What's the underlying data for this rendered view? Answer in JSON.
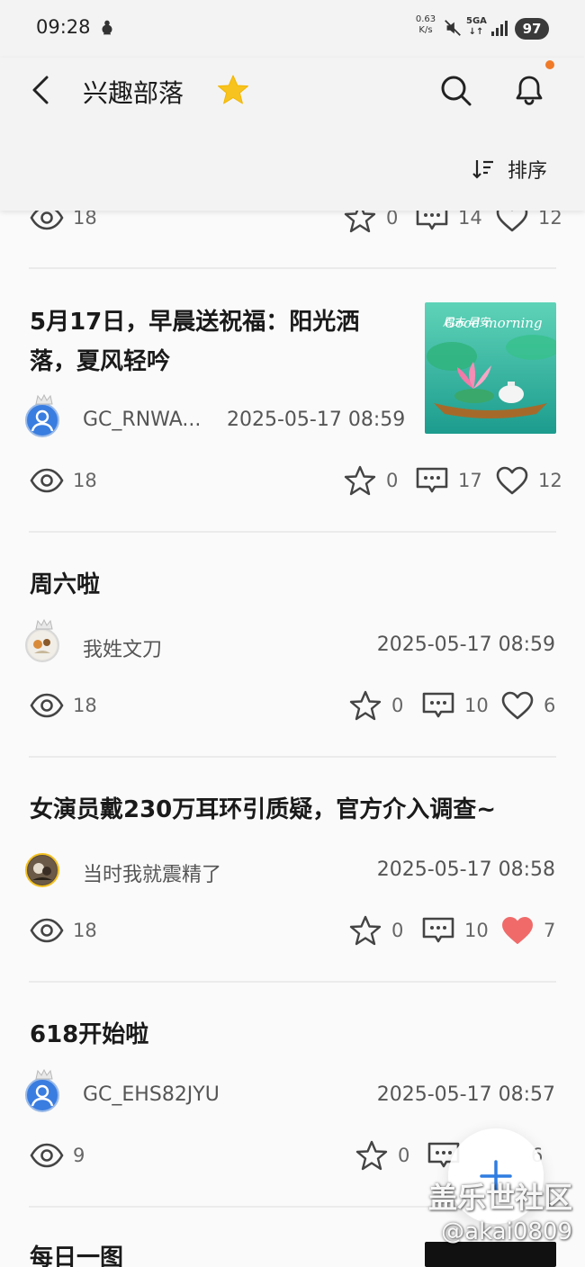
{
  "status_bar": {
    "time": "09:28",
    "net_speed_value": "0.63",
    "net_speed_unit": "K/s",
    "network": "5GA",
    "battery": "97"
  },
  "header": {
    "title": "兴趣部落",
    "sort_label": "排序",
    "accent": "#f7c31e",
    "notify_dot_color": "#f07a28"
  },
  "partial_post": {
    "views": "18",
    "favorites": "0",
    "comments": "14",
    "likes": "12"
  },
  "posts": [
    {
      "title": "5月17日，早晨送祝福：阳光洒落，夏风轻吟",
      "author": "GC_RNWA...",
      "time": "2025-05-17 08:59",
      "views": "18",
      "favorites": "0",
      "comments": "17",
      "likes": "12",
      "liked": false,
      "thumbnail_text": "Good morning",
      "thumbnail_caption": "周末·早安"
    },
    {
      "title": "周六啦",
      "author": "我姓文刀",
      "time": "2025-05-17 08:59",
      "views": "18",
      "favorites": "0",
      "comments": "10",
      "likes": "6",
      "liked": false
    },
    {
      "title": "女演员戴230万耳环引质疑，官方介入调查~",
      "author": "当时我就震精了",
      "time": "2025-05-17 08:58",
      "views": "18",
      "favorites": "0",
      "comments": "10",
      "likes": "7",
      "liked": true
    },
    {
      "title": "618开始啦",
      "author": "GC_EHS82JYU",
      "time": "2025-05-17 08:57",
      "views": "9",
      "favorites": "0",
      "comments": "",
      "likes": "6",
      "liked": false
    },
    {
      "title": "每日一图"
    }
  ],
  "colors": {
    "liked_heart": "#f06a6a",
    "fab_plus": "#2f7de1"
  },
  "watermark": {
    "line1": "盖乐世社区",
    "line2": "@akai0809"
  }
}
